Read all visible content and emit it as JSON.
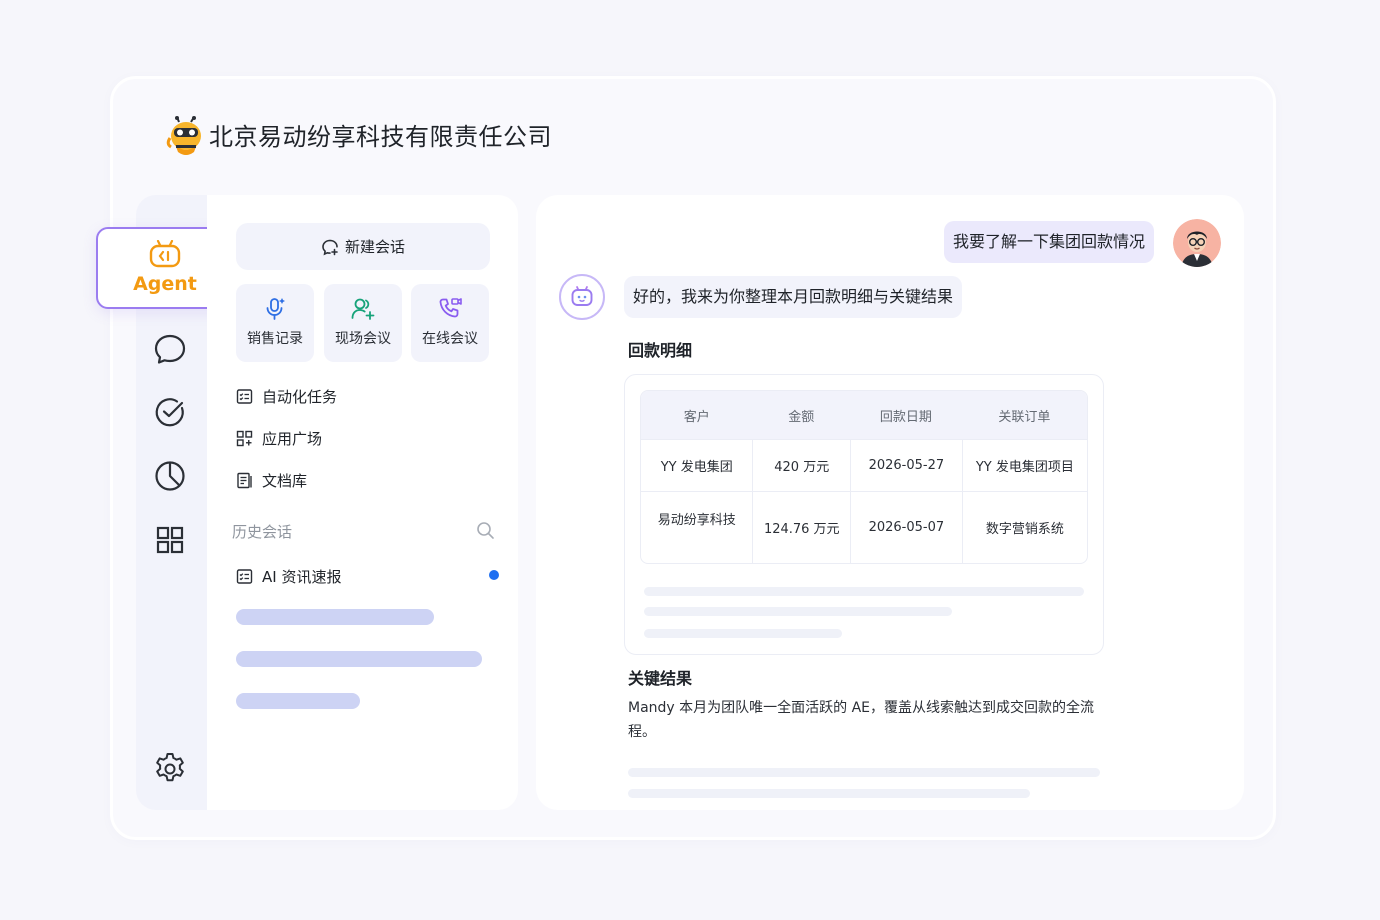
{
  "company": {
    "name": "北京易动纷享科技有限责任公司",
    "logo_icon": "bee-mascot-icon"
  },
  "rail": {
    "agent_label": "Agent",
    "items": [
      "ai-agent-icon",
      "chat-bubble-icon",
      "check-circle-icon",
      "pie-chart-icon",
      "grid-apps-icon"
    ],
    "settings_icon": "gear-icon"
  },
  "sidebar": {
    "new_chat": "新建会话",
    "quick_actions": [
      {
        "label": "销售记录",
        "icon": "microphone-icon"
      },
      {
        "label": "现场会议",
        "icon": "users-icon"
      },
      {
        "label": "在线会议",
        "icon": "phone-video-icon"
      }
    ],
    "menu": [
      {
        "label": "自动化任务",
        "icon": "task-list-icon"
      },
      {
        "label": "应用广场",
        "icon": "app-grid-icon"
      },
      {
        "label": "文档库",
        "icon": "document-icon"
      }
    ],
    "history_title": "历史会话",
    "history": [
      {
        "label": "AI 资讯速报",
        "unread": true
      }
    ]
  },
  "chat": {
    "user_message": "我要了解一下集团回款情况",
    "bot_message": "好的，我来为你整理本月回款明细与关键结果",
    "section1_title": "回款明细",
    "table": {
      "headers": [
        "客户",
        "金额",
        "回款日期",
        "关联订单"
      ],
      "rows": [
        [
          "YY 发电集团",
          "420 万元",
          "2026-05-27",
          "YY 发电集团项目"
        ],
        [
          "易动纷享科技",
          "124.76 万元",
          "2026-05-07",
          "数字营销系统"
        ]
      ]
    },
    "section2_title": "关键结果",
    "result_text": "Mandy 本月为团队唯一全面活跃的 AE，覆盖从线索触达到成交回款的全流程。"
  },
  "colors": {
    "accent_orange": "#f39a12",
    "accent_purple": "#9b7cf0",
    "unread_blue": "#1e6ff1"
  }
}
